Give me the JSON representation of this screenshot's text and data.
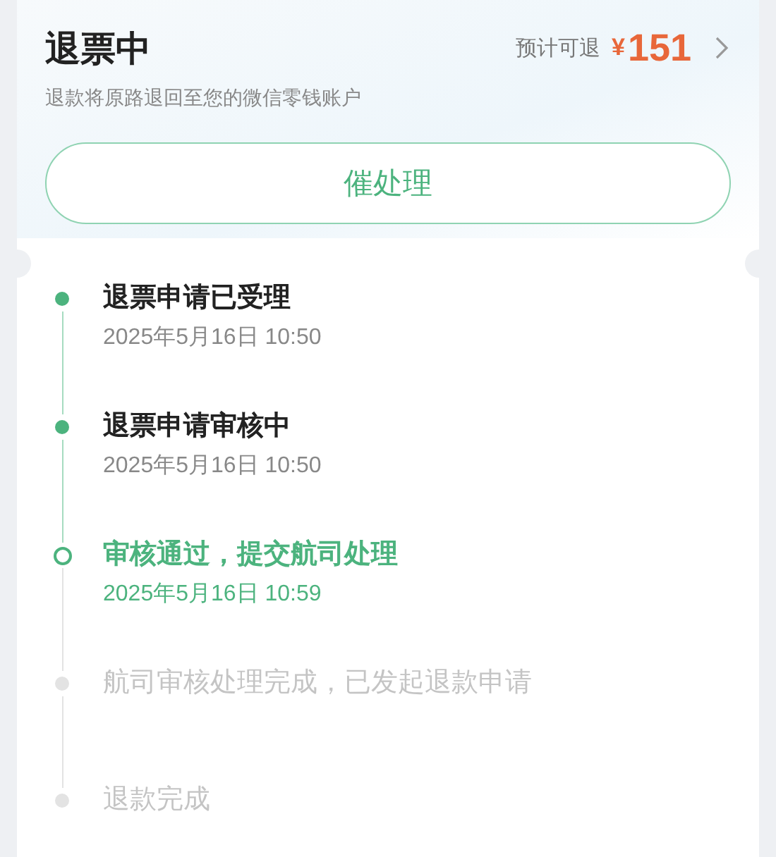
{
  "header": {
    "title": "退票中",
    "refund_label": "预计可退",
    "currency": "¥",
    "amount": "151",
    "subtitle": "退款将原路退回至您的微信零钱账户"
  },
  "urge_button": "催处理",
  "steps": [
    {
      "title": "退票申请已受理",
      "time": "2025年5月16日 10:50",
      "kind": "done"
    },
    {
      "title": "退票申请审核中",
      "time": "2025年5月16日 10:50",
      "kind": "done"
    },
    {
      "title": "审核通过，提交航司处理",
      "time": "2025年5月16日 10:59",
      "kind": "current"
    },
    {
      "title": "航司审核处理完成，已发起退款申请",
      "kind": "pending"
    },
    {
      "title": "退款完成",
      "kind": "pending"
    }
  ]
}
